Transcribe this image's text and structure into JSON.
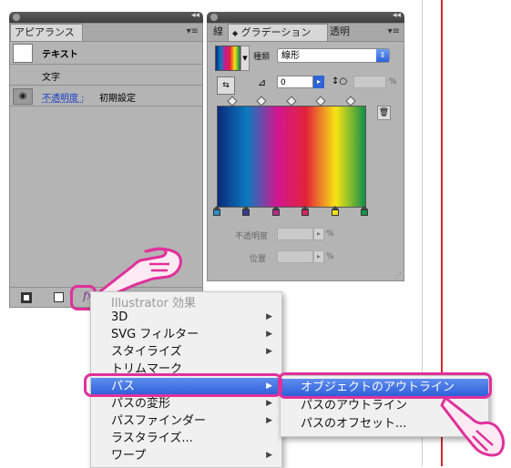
{
  "appearance_panel": {
    "tab": "アピアランス",
    "rows": [
      {
        "label": "テキスト"
      },
      {
        "label": "文字"
      },
      {
        "label": "不透明度 :",
        "value": "初期設定"
      }
    ],
    "fx_label": "fx"
  },
  "gradient_panel": {
    "tabs": [
      "線",
      "グラデーション",
      "透明"
    ],
    "type_label": "種類",
    "type_value": "線形",
    "angle_value": "0",
    "percent_unit": "%",
    "opacity_label": "不透明度",
    "position_label": "位置",
    "stop_colors": [
      "#2a8fc8",
      "#3b3c8f",
      "#b52a8f",
      "#d62560",
      "#f0e21e",
      "#18944d"
    ],
    "gradient_colors": [
      "#0a2a7a",
      "#0b7bc0",
      "#cf1791",
      "#e2233a",
      "#f7e414",
      "#11904a"
    ]
  },
  "effect_menu": {
    "header": "Illustrator 効果",
    "items": [
      {
        "label": "3D",
        "submenu": true
      },
      {
        "label": "SVG フィルター",
        "submenu": true
      },
      {
        "label": "スタイライズ",
        "submenu": true
      },
      {
        "label": "トリムマーク",
        "submenu": false
      },
      {
        "label": "パス",
        "submenu": true,
        "selected": true
      },
      {
        "label": "パスの変形",
        "submenu": true
      },
      {
        "label": "パスファインダー",
        "submenu": true
      },
      {
        "label": "ラスタライズ...",
        "submenu": false
      },
      {
        "label": "ワープ",
        "submenu": true
      }
    ]
  },
  "path_submenu": {
    "items": [
      {
        "label": "オブジェクトのアウトライン",
        "selected": true
      },
      {
        "label": "パスのアウトライン",
        "selected": false
      },
      {
        "label": "パスのオフセット...",
        "selected": false
      }
    ]
  },
  "colors": {
    "highlight": "#e0309a",
    "selection": "#2e5fdb",
    "guide": "#d0282a"
  }
}
